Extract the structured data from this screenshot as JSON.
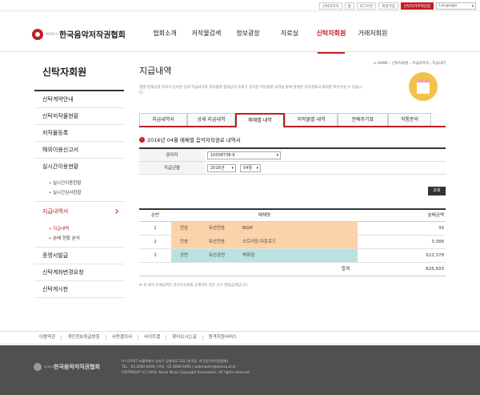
{
  "util": [
    "신탁자이이",
    "홈",
    "로그아웃",
    "회원가입",
    "신탁자가부여인증"
  ],
  "language": "Language",
  "logo": {
    "small": "KOMCA",
    "name": "한국음악저작권협회"
  },
  "gnb": [
    "협회소개",
    "저작물검색",
    "정보광장",
    "자료실",
    "신탁자회원",
    "거래처회원"
  ],
  "gnb_active": 4,
  "lnb": {
    "title": "신탁자회원",
    "items": [
      "신탁계약안내",
      "신탁저작물현황",
      "저작물등록",
      "해외이용신고서",
      "실시간이용현황"
    ],
    "sub1": [
      "실시간이용현황",
      "실시간심사현황"
    ],
    "active": "지급내역서",
    "sub2": [
      "지급내역",
      "분배 현황 분석"
    ],
    "items2": [
      "증명서발급",
      "신탁계좌변경요청",
      "신탁게시판"
    ]
  },
  "content": {
    "title": "지급내역",
    "breadcrumb": "⌂ HOME › 신탁자회원 › 지급내역서 › 지급내역",
    "desc": "월별 합계금액 조회가 용이한 상세 지급내역과 저작물별 합계금액 조회가 용이한 저작물별 내역을 통해 발생한 저작권료의 출처를 확인하실 수 있습니다.",
    "tabs": [
      "지급내역서",
      "상세 지급내역",
      "매체별 내역",
      "저작물별 내역",
      "분배주기표",
      "직통문의"
    ],
    "active_tab": 2,
    "report_title": "2016년 04월 매체별 음악저작권료 내역서",
    "form": {
      "label_holder": "권리자",
      "holder_value": "10008738-9",
      "label_month": "지급년월",
      "year": "2016년",
      "month": "04월"
    },
    "search_button": "조회",
    "table": {
      "headers": [
        "순번",
        "매체명",
        "분배금액"
      ],
      "rows": [
        {
          "no": "1",
          "g1": "전송",
          "g2": "유선전송",
          "name": "BGM",
          "amount": "39",
          "color": "peach"
        },
        {
          "no": "2",
          "g1": "전송",
          "g2": "유선전송",
          "name": "스트리밍,다운로드",
          "amount": "3,086",
          "color": "peach"
        },
        {
          "no": "3",
          "g1": "공연",
          "g2": "유선공연",
          "name": "박화점",
          "amount": "622,378",
          "color": "mint"
        }
      ],
      "total_label": "합계",
      "total": "625,503"
    },
    "footnote": "※ 위 표의 분배금액은 관리수수료를 공제하지 않은 순수 발생금액입니다."
  },
  "footer_nav": [
    "이용약관",
    "개인정보취급방침",
    "서면결의서",
    "사이트맵",
    "찾아오시는길",
    "원격지원서비스"
  ],
  "footer": {
    "logo": "한국음악저작권협회",
    "line1": "우) 07647 서울특별시 강서구 공항대로 332 (마곡동, 한국음악저작권협회)",
    "line2": "TEL : 02-2660-0400 | FAX : 02-2660-0401 | webmaster@komca.or.kr",
    "line3": "COPYRIGHT (C) 2014. Korea Music Copyright Association, All rights reserved."
  }
}
